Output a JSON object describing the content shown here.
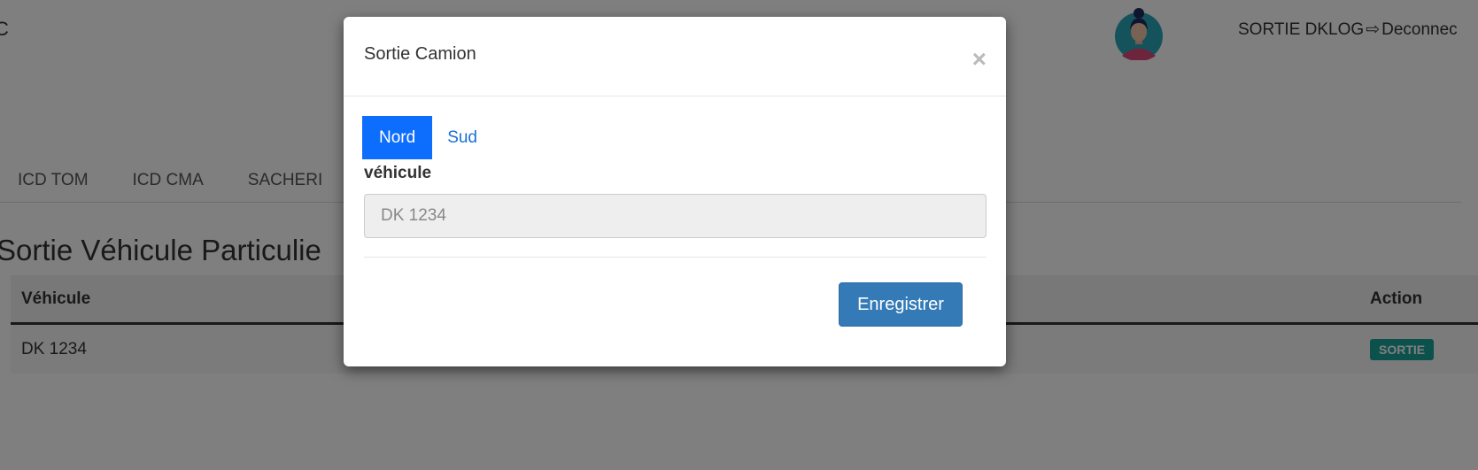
{
  "header": {
    "brand_fragment": "C",
    "user_name": "SORTIE DKLOG",
    "logout_icon": "logout-icon",
    "logout_label": "Deconnec"
  },
  "nav": {
    "items": [
      "ICD TOM",
      "ICD CMA",
      "SACHERI"
    ]
  },
  "page": {
    "title": "Sortie Véhicule Particulie"
  },
  "table": {
    "columns": [
      "Véhicule",
      "Action"
    ],
    "rows": [
      {
        "vehicule": "DK 1234",
        "action": "SORTIE"
      }
    ],
    "badge_color": "#1aa39a"
  },
  "modal": {
    "title": "Sortie Camion",
    "close_symbol": "×",
    "tabs": [
      {
        "label": "Nord",
        "active": true
      },
      {
        "label": "Sud",
        "active": false
      }
    ],
    "field_label": "véhicule",
    "field_value": "DK 1234",
    "save_label": "Enregistrer",
    "accent_color": "#0d6efd",
    "save_color": "#337ab7"
  }
}
